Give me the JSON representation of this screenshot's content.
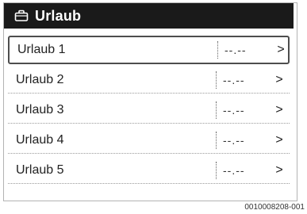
{
  "header": {
    "title": "Urlaub",
    "icon": "suitcase-icon"
  },
  "items": [
    {
      "label": "Urlaub 1",
      "value": "--.--",
      "chevron": ">",
      "selected": true
    },
    {
      "label": "Urlaub 2",
      "value": "--.--",
      "chevron": ">"
    },
    {
      "label": "Urlaub 3",
      "value": "--.--",
      "chevron": ">"
    },
    {
      "label": "Urlaub 4",
      "value": "--.--",
      "chevron": ">"
    },
    {
      "label": "Urlaub 5",
      "value": "--.--",
      "chevron": ">"
    }
  ],
  "footer": {
    "doc_id": "0010008208-001"
  }
}
